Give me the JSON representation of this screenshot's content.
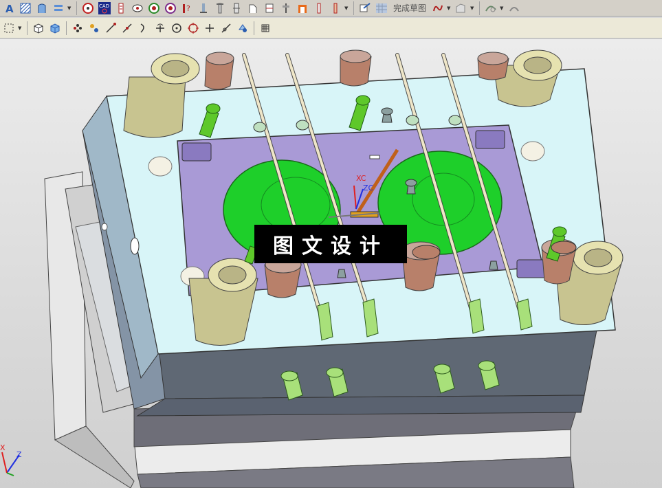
{
  "toolbar": {
    "sketch_label": "完成草图",
    "icons_row1": [
      "text-icon",
      "hatch-icon",
      "table-icon",
      "list-icon",
      "circle-target-icon",
      "cad-icon",
      "gate-icon",
      "eject-icon",
      "cooling-icon",
      "target-icon",
      "help-pin-icon",
      "pin-icon",
      "pin2-icon",
      "support-icon",
      "lift-icon",
      "slide-icon",
      "punch-icon",
      "pillar-icon",
      "pipe-icon",
      "cutter-icon"
    ],
    "icons_row2": [
      "select-box-icon",
      "cube-view-icon",
      "shaded-cube-icon",
      "snap-points-icon",
      "snap-mid-icon",
      "line-icon",
      "line2-icon",
      "arc-icon",
      "intersection-icon",
      "center-icon",
      "quadrant-icon",
      "point-icon",
      "tangent-icon",
      "feature-icon",
      "grid-icon"
    ]
  },
  "watermark": {
    "text": "图文设计"
  },
  "triad": {
    "xc": "XC",
    "zc": "ZC"
  },
  "corner_axis": {
    "x": "X",
    "z": "Z"
  }
}
